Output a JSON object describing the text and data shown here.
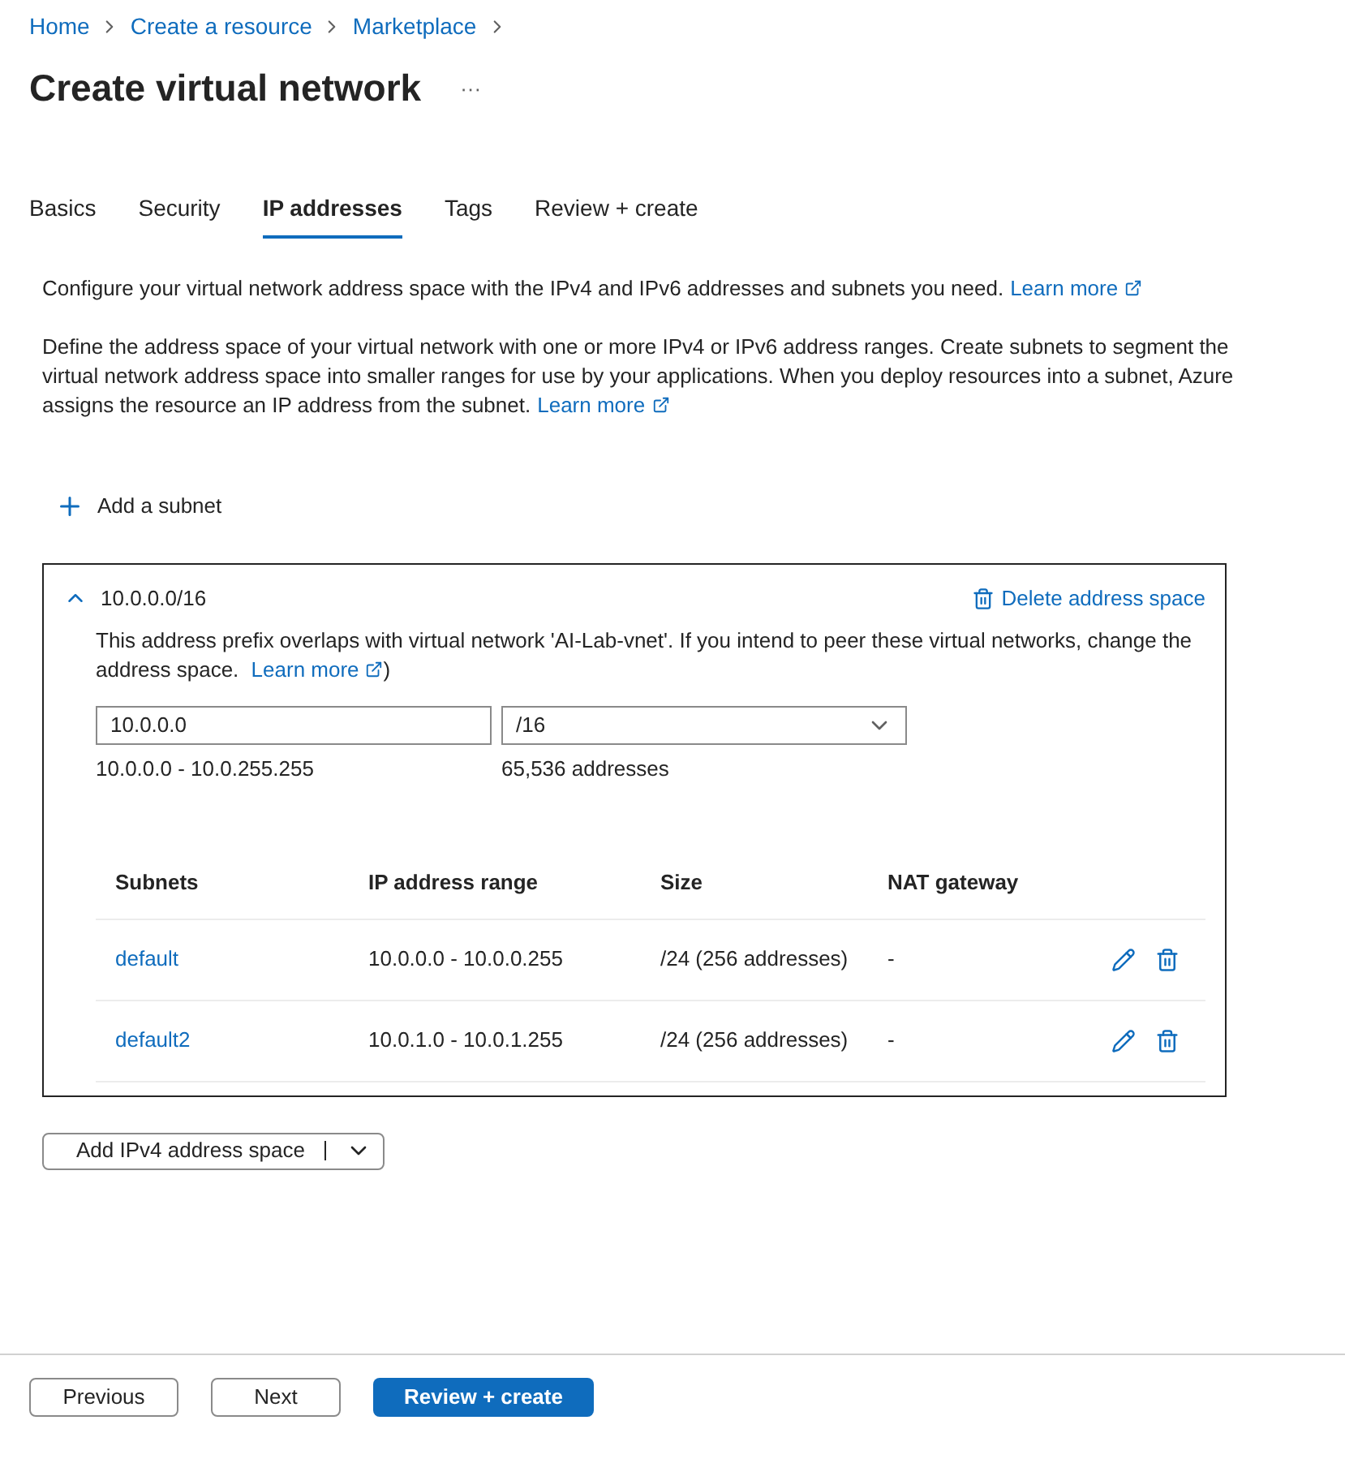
{
  "breadcrumb": [
    "Home",
    "Create a resource",
    "Marketplace"
  ],
  "title": "Create virtual network",
  "more_label": "···",
  "tabs": [
    {
      "label": "Basics",
      "selected": false
    },
    {
      "label": "Security",
      "selected": false
    },
    {
      "label": "IP addresses",
      "selected": true
    },
    {
      "label": "Tags",
      "selected": false
    },
    {
      "label": "Review + create",
      "selected": false
    }
  ],
  "intro": {
    "text": "Configure your virtual network address space with the IPv4 and IPv6 addresses and subnets you need.",
    "link": "Learn more"
  },
  "description": {
    "text": "Define the address space of your virtual network with one or more IPv4 or IPv6 address ranges. Create subnets to segment the virtual network address space into smaller ranges for use by your applications. When you deploy resources into a subnet, Azure assigns the resource an IP address from the subnet.",
    "link": "Learn more"
  },
  "add_subnet": "Add a subnet",
  "address_space": {
    "title": "10.0.0.0/16",
    "expanded": true,
    "delete_label": "Delete address space",
    "warning": {
      "text": "This address prefix overlaps with virtual network 'AI-Lab-vnet'. If you intend to peer these virtual networks, change the address space.",
      "link": "Learn more",
      "suffix": ")"
    },
    "address_value": "10.0.0.0",
    "prefix_value": "/16",
    "range": "10.0.0.0 - 10.0.255.255",
    "count": "65,536 addresses",
    "columns": [
      "Subnets",
      "IP address range",
      "Size",
      "NAT gateway"
    ],
    "rows": [
      {
        "name": "default",
        "range": "10.0.0.0 - 10.0.0.255",
        "size": "/24 (256 addresses)",
        "nat": "-"
      },
      {
        "name": "default2",
        "range": "10.0.1.0 - 10.0.1.255",
        "size": "/24 (256 addresses)",
        "nat": "-"
      }
    ]
  },
  "add_space_button": "Add IPv4 address space",
  "footer": {
    "previous": "Previous",
    "next": "Next",
    "review": "Review + create"
  }
}
